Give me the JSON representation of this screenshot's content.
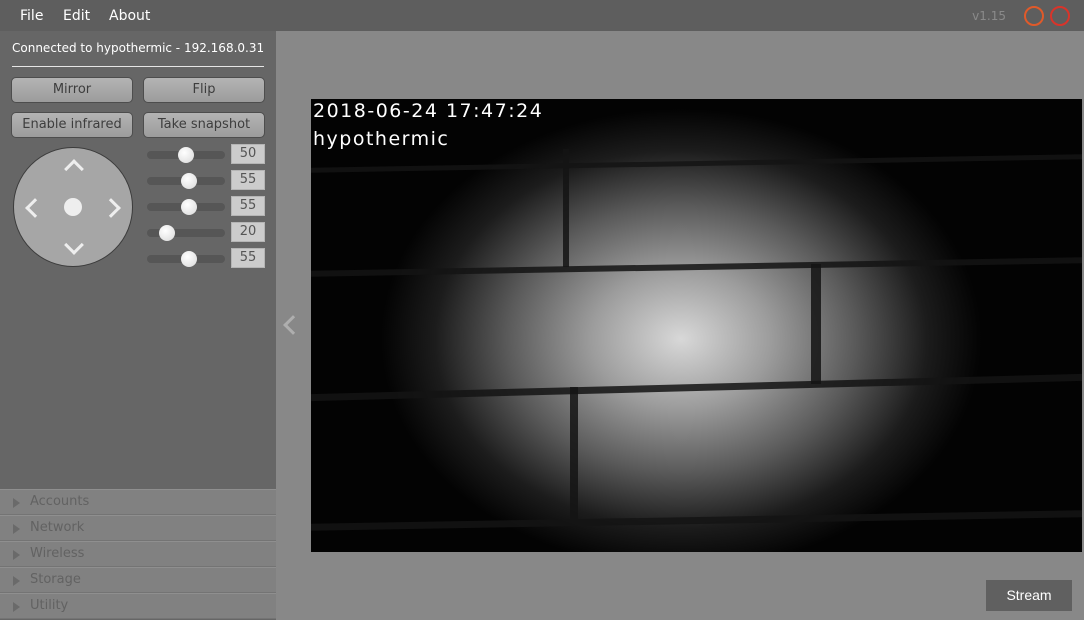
{
  "menubar": {
    "items": [
      "File",
      "Edit",
      "About"
    ],
    "version": "v1.15",
    "minimize_color": "#e05a2a",
    "close_color": "#d9342a"
  },
  "sidebar": {
    "connection_status": "Connected to hypothermic - 192.168.0.31",
    "buttons": {
      "mirror": "Mirror",
      "flip": "Flip",
      "enable_infrared": "Enable infrared",
      "take_snapshot": "Take snapshot"
    },
    "sliders": [
      {
        "value": "50",
        "fraction": 0.5
      },
      {
        "value": "55",
        "fraction": 0.55
      },
      {
        "value": "55",
        "fraction": 0.55
      },
      {
        "value": "20",
        "fraction": 0.2
      },
      {
        "value": "55",
        "fraction": 0.55
      }
    ],
    "sections": [
      "Accounts",
      "Network",
      "Wireless",
      "Storage",
      "Utility"
    ]
  },
  "video": {
    "timestamp": "2018-06-24 17:47:24",
    "camera_name": "hypothermic"
  },
  "stream_button": "Stream"
}
